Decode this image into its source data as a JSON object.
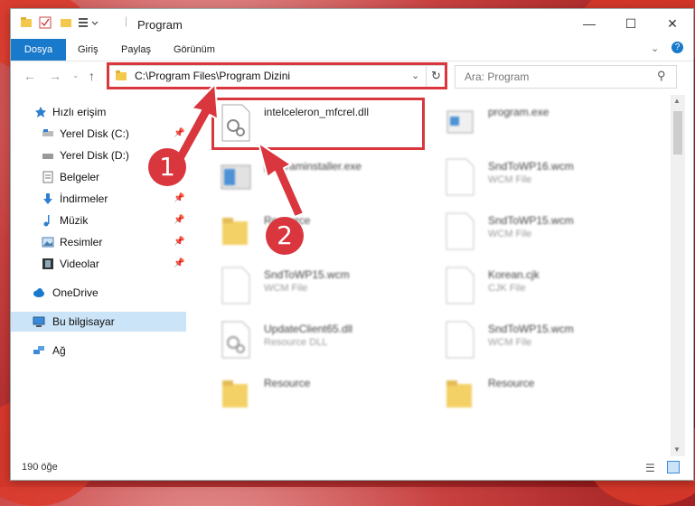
{
  "window": {
    "title": "Program"
  },
  "ribbon": {
    "tabs": [
      "Dosya",
      "Giriş",
      "Paylaş",
      "Görünüm"
    ]
  },
  "address": {
    "path": "C:\\Program Files\\Program Dizini"
  },
  "search": {
    "placeholder": "Ara: Program"
  },
  "sidebar": {
    "items": [
      {
        "label": "Hızlı erişim",
        "icon": "star-icon"
      },
      {
        "label": "Yerel Disk (C:)",
        "icon": "drive-icon"
      },
      {
        "label": "Yerel Disk (D:)",
        "icon": "drive-icon"
      },
      {
        "label": "Belgeler",
        "icon": "document-icon"
      },
      {
        "label": "İndirmeler",
        "icon": "download-icon"
      },
      {
        "label": "Müzik",
        "icon": "music-icon"
      },
      {
        "label": "Resimler",
        "icon": "pictures-icon"
      },
      {
        "label": "Videolar",
        "icon": "video-icon"
      },
      {
        "label": "OneDrive",
        "icon": "cloud-icon"
      },
      {
        "label": "Bu bilgisayar",
        "icon": "computer-icon"
      },
      {
        "label": "Ağ",
        "icon": "network-icon"
      }
    ]
  },
  "files": [
    {
      "name": "intelceleron_mfcrel.dll",
      "type": ""
    },
    {
      "name": "program.exe",
      "type": ""
    },
    {
      "name": "programinstaller.exe",
      "type": ""
    },
    {
      "name": "SndToWP16.wcm",
      "type": "WCM File"
    },
    {
      "name": "Resource",
      "type": ""
    },
    {
      "name": "SndToWP15.wcm",
      "type": "WCM File"
    },
    {
      "name": "SndToWP15.wcm",
      "type": "WCM File"
    },
    {
      "name": "Korean.cjk",
      "type": "CJK File"
    },
    {
      "name": "UpdateClient65.dll",
      "type": "Resource DLL"
    },
    {
      "name": "SndToWP15.wcm",
      "type": "WCM File"
    },
    {
      "name": "Resource",
      "type": ""
    },
    {
      "name": "Resource",
      "type": ""
    }
  ],
  "status": {
    "count": "190 öğe"
  },
  "badges": {
    "one": "1",
    "two": "2"
  },
  "colors": {
    "accent": "#1979ca",
    "highlight": "#d9363e",
    "selection": "#cce4f7"
  }
}
